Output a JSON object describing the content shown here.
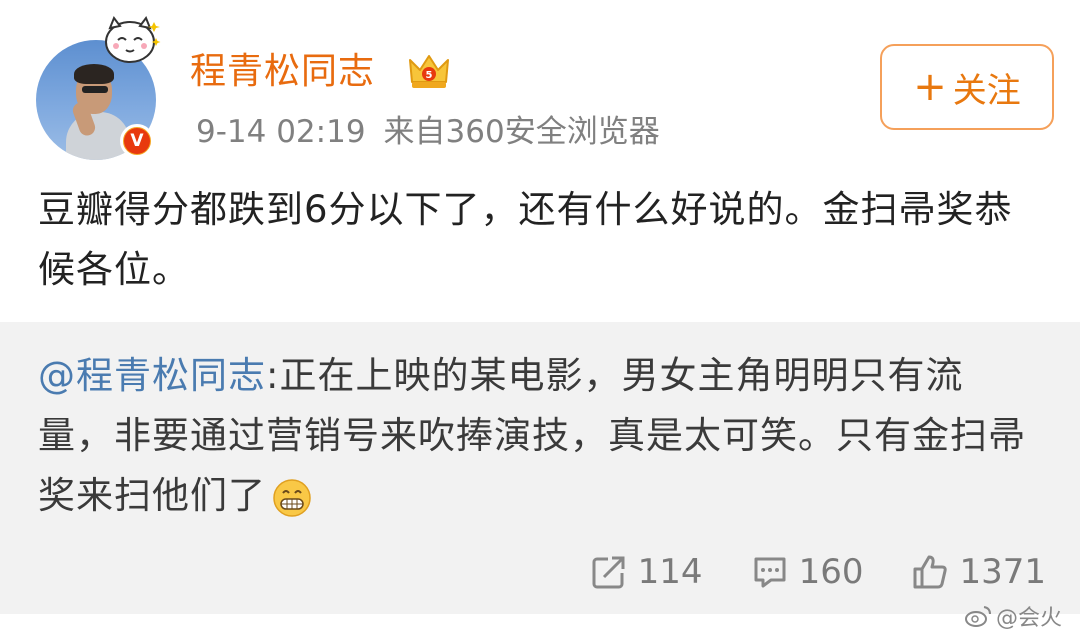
{
  "header": {
    "username": "程青松同志",
    "timestamp": "9-14 02:19",
    "source": "来自360安全浏览器",
    "follow_plus": "+",
    "follow_label": "关注"
  },
  "post": {
    "text": "豆瓣得分都跌到6分以下了，还有什么好说的。金扫帚奖恭候各位。"
  },
  "quote": {
    "author": "@程青松同志",
    "colon": ":",
    "text": "正在上映的某电影，男女主角明明只有流量，非要通过营销号来吹捧演技，真是太可笑。只有金扫帚奖来扫他们了",
    "emoji": "grin-icon"
  },
  "actions": {
    "repost_count": "114",
    "comment_count": "160",
    "like_count": "1371"
  },
  "watermark": {
    "text": "@会火"
  },
  "colors": {
    "username": "#e86b0f",
    "link": "#4a7bb0",
    "follow_border": "#f5a05a",
    "quote_bg": "#f2f2f2",
    "verified_badge": "#e8390e"
  }
}
